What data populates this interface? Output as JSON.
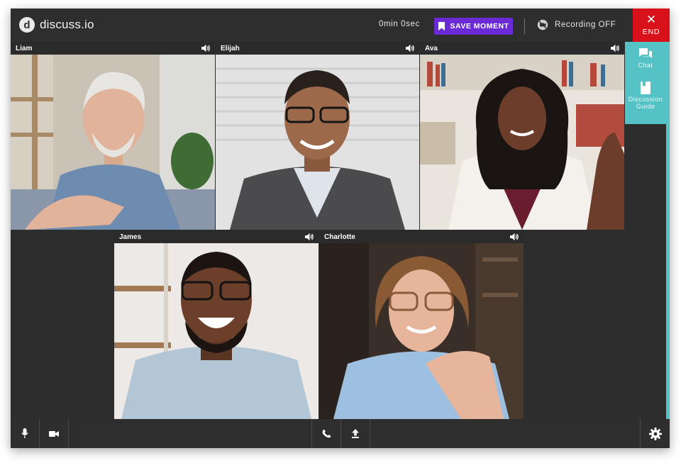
{
  "app": {
    "logo_letter": "d",
    "name": "discuss.io"
  },
  "header": {
    "timer": "0min 0sec",
    "save_moment_label": "SAVE MOMENT",
    "recording_status": "Recording OFF",
    "end_label": "END",
    "end_glyph": "✕"
  },
  "participants": [
    {
      "name": "Liam",
      "audio_icon": "speaker-icon"
    },
    {
      "name": "Elijah",
      "audio_icon": "speaker-icon"
    },
    {
      "name": "Ava",
      "audio_icon": "speaker-icon"
    },
    {
      "name": "James",
      "audio_icon": "speaker-icon"
    },
    {
      "name": "Charlotte",
      "audio_icon": "speaker-icon"
    }
  ],
  "side_panel": {
    "chat_label": "Chat",
    "guide_label_line1": "Discussion",
    "guide_label_line2": "Guide"
  },
  "toolbar": {
    "icons": [
      "microphone-icon",
      "camera-icon",
      "phone-icon",
      "upload-icon",
      "gear-icon"
    ]
  },
  "colors": {
    "accent_purple": "#6a2bd6",
    "end_red": "#d8111a",
    "panel_teal": "#55c3c6",
    "background": "#2e2e2e"
  }
}
